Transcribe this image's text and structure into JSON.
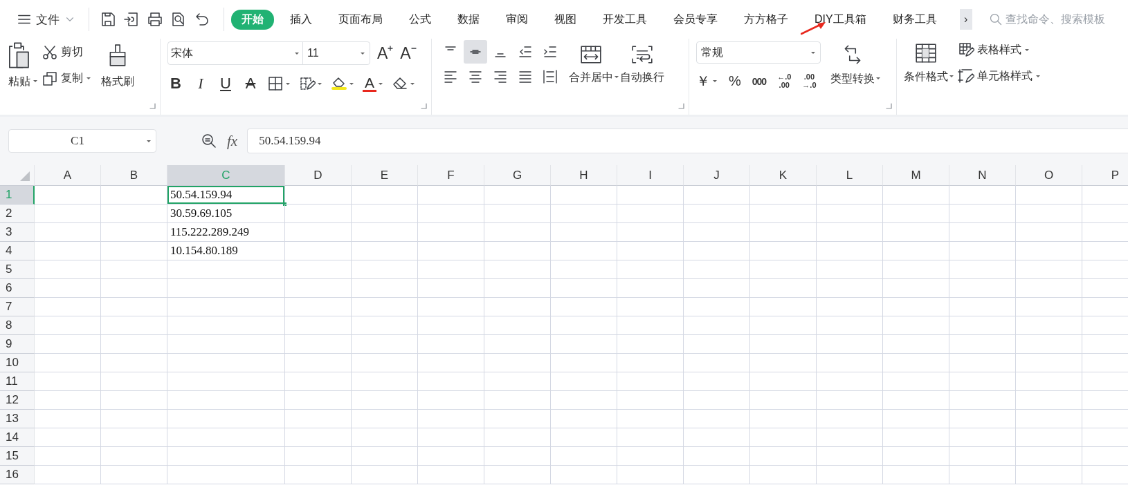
{
  "menu_bar": {
    "file_menu": "文件",
    "tabs": [
      {
        "label": "开始",
        "selected": true
      },
      {
        "label": "插入",
        "selected": false
      },
      {
        "label": "页面布局",
        "selected": false
      },
      {
        "label": "公式",
        "selected": false
      },
      {
        "label": "数据",
        "selected": false
      },
      {
        "label": "审阅",
        "selected": false
      },
      {
        "label": "视图",
        "selected": false
      },
      {
        "label": "开发工具",
        "selected": false
      },
      {
        "label": "会员专享",
        "selected": false
      },
      {
        "label": "方方格子",
        "selected": false
      },
      {
        "label": "DIY工具箱",
        "selected": false
      },
      {
        "label": "财务工具",
        "selected": false
      }
    ],
    "more": "›",
    "search": {
      "placeholder": "查找命令、搜索模板"
    }
  },
  "ribbon": {
    "clipboard": {
      "paste": "粘贴",
      "cut": "剪切",
      "copy": "复制",
      "format_painter": "格式刷"
    },
    "font": {
      "font_name": "宋体",
      "font_size": "11",
      "grow": "A",
      "shrink": "A",
      "buttons": [
        {
          "kind": "bold",
          "label": "B"
        },
        {
          "kind": "italic",
          "label": "I"
        },
        {
          "kind": "underline",
          "label": "U"
        },
        {
          "kind": "strike",
          "label": "A"
        },
        {
          "kind": "border"
        },
        {
          "kind": "tint"
        },
        {
          "kind": "fill"
        },
        {
          "kind": "fontcolor",
          "label": "A"
        },
        {
          "kind": "eraser"
        }
      ]
    },
    "alignment": {
      "buttons": [
        {
          "kind": "top",
          "selected": false
        },
        {
          "kind": "middle",
          "selected": true
        },
        {
          "kind": "bottom",
          "selected": false
        },
        {
          "kind": "outdent",
          "selected": false
        },
        {
          "kind": "indent",
          "selected": false
        },
        {
          "kind": "left",
          "selected": false
        },
        {
          "kind": "center",
          "selected": false
        },
        {
          "kind": "right",
          "selected": false
        },
        {
          "kind": "justify",
          "selected": false
        },
        {
          "kind": "distribute",
          "selected": false
        }
      ],
      "merge": "合并居中",
      "wrap": "自动换行"
    },
    "number": {
      "format": "常规",
      "currency": "￥",
      "percent": "%",
      "thousands": "000",
      "decimal_increase": {
        "top": "←.0",
        "bottom": ".00"
      },
      "decimal_decrease": {
        "top": ".00",
        "bottom": "→.0"
      },
      "convert": "类型转换"
    },
    "styles": {
      "conditional": "条件格式",
      "table_style": "表格样式",
      "cell_style": "单元格样式"
    }
  },
  "formula_bar": {
    "name_box": "C1",
    "fx": "fx",
    "value": "50.54.159.94"
  },
  "sheet": {
    "columns": [
      {
        "label": "A",
        "selected": false
      },
      {
        "label": "B",
        "selected": false
      },
      {
        "label": "C",
        "selected": true
      },
      {
        "label": "D",
        "selected": false
      },
      {
        "label": "E",
        "selected": false
      },
      {
        "label": "F",
        "selected": false
      },
      {
        "label": "G",
        "selected": false
      },
      {
        "label": "H",
        "selected": false
      },
      {
        "label": "I",
        "selected": false
      },
      {
        "label": "J",
        "selected": false
      },
      {
        "label": "K",
        "selected": false
      },
      {
        "label": "L",
        "selected": false
      },
      {
        "label": "M",
        "selected": false
      },
      {
        "label": "N",
        "selected": false
      },
      {
        "label": "O",
        "selected": false
      },
      {
        "label": "P",
        "selected": false
      }
    ],
    "rows": [
      {
        "label": "1",
        "selected": true,
        "cells": {
          "C": "50.54.159.94"
        }
      },
      {
        "label": "2",
        "selected": false,
        "cells": {
          "C": "30.59.69.105"
        }
      },
      {
        "label": "3",
        "selected": false,
        "cells": {
          "C": "115.222.289.249"
        }
      },
      {
        "label": "4",
        "selected": false,
        "cells": {
          "C": "10.154.80.189"
        }
      },
      {
        "label": "5",
        "selected": false
      },
      {
        "label": "6",
        "selected": false
      },
      {
        "label": "7",
        "selected": false
      },
      {
        "label": "8",
        "selected": false
      },
      {
        "label": "9",
        "selected": false
      },
      {
        "label": "10",
        "selected": false
      },
      {
        "label": "11",
        "selected": false
      },
      {
        "label": "12",
        "selected": false
      },
      {
        "label": "13",
        "selected": false
      },
      {
        "label": "14",
        "selected": false
      },
      {
        "label": "15",
        "selected": false
      },
      {
        "label": "16",
        "selected": false
      }
    ]
  }
}
